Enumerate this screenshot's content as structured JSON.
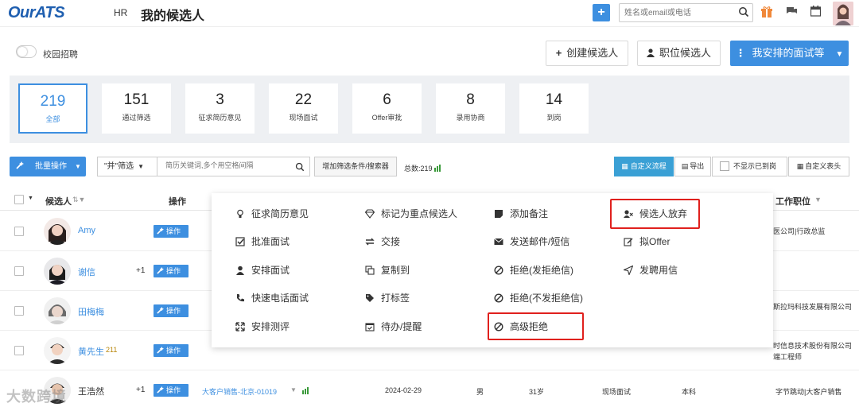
{
  "header": {
    "logo": "OurATS",
    "role": "HR",
    "title": "我的候选人",
    "search_placeholder": "姓名或email或电话"
  },
  "toolbar": {
    "campus_toggle_label": "校园招聘",
    "create_candidate": "创建候选人",
    "position_candidate": "职位候选人",
    "my_interviews": "我安排的面试等"
  },
  "stats": [
    {
      "value": "219",
      "label": "全部",
      "active": true
    },
    {
      "value": "151",
      "label": "通过筛选"
    },
    {
      "value": "3",
      "label": "征求简历意见"
    },
    {
      "value": "22",
      "label": "现场面试"
    },
    {
      "value": "6",
      "label": "Offer审批"
    },
    {
      "value": "8",
      "label": "录用协商"
    },
    {
      "value": "14",
      "label": "到岗"
    }
  ],
  "filter": {
    "batch_ops": "批量操作",
    "screen_select": "\"并\"筛选",
    "keyword_placeholder": "简历关键词,多个用空格间隔",
    "add_filter": "增加筛选条件/搜索器",
    "total": "总数:219",
    "custom_workflow": "自定义流程",
    "export": "导出",
    "hide_arrived": "不显示已到岗",
    "custom_header": "自定义表头"
  },
  "table": {
    "headers": {
      "candidate": "候选人",
      "operation": "操作",
      "work_position": "工作职位"
    },
    "op_label": "操作",
    "rows": [
      {
        "name": "Amy",
        "work": "医公司|行政总监"
      },
      {
        "name": "谢信",
        "plus": "+1",
        "work": ""
      },
      {
        "name": "田梅梅",
        "work": "斯拉玛科技发展有限公司"
      },
      {
        "name": "黄先生",
        "extra": "211",
        "work": "时信息技术股份有限公司",
        "work2": "端工程师"
      },
      {
        "name": "王浩然",
        "plus": "+1",
        "position": "大客户销售-北京-01019",
        "date": "2024-02-29",
        "gender": "男",
        "age": "31岁",
        "stage": "现场面试",
        "degree": "本科",
        "work": "字节跳动|大客户销售"
      }
    ]
  },
  "menu": {
    "col1": [
      "征求简历意见",
      "批准面试",
      "安排面试",
      "快速电话面试",
      "安排测评"
    ],
    "col2": [
      "标记为重点候选人",
      "交接",
      "复制到",
      "打标签",
      "待办/提醒"
    ],
    "col3": [
      "添加备注",
      "发送邮件/短信",
      "拒绝(发拒绝信)",
      "拒绝(不发拒绝信)",
      "高级拒绝"
    ],
    "col4": [
      "候选人放弃",
      "拟Offer",
      "发聘用信"
    ]
  },
  "watermark": "大数跨境",
  "colors": {
    "primary": "#3d8fe0",
    "highlight": "#e0201d"
  }
}
